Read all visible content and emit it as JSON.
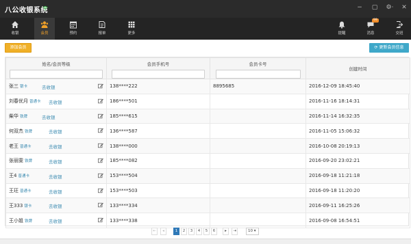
{
  "app": {
    "title": "八公收银系统"
  },
  "window": {
    "minimize": "−",
    "maximize": "▢",
    "settings": "⚙·",
    "close": "✕"
  },
  "nav": {
    "left": [
      {
        "label": "收银",
        "icon": "home-icon"
      },
      {
        "label": "会员",
        "icon": "members-icon",
        "active": true
      },
      {
        "label": "预约",
        "icon": "calendar-icon"
      },
      {
        "label": "报单",
        "icon": "report-icon"
      },
      {
        "label": "更多",
        "icon": "grid-icon"
      }
    ],
    "right": [
      {
        "label": "提醒",
        "icon": "bell-icon"
      },
      {
        "label": "消息",
        "icon": "message-icon",
        "badge": "99"
      },
      {
        "label": "交班",
        "icon": "exit-icon"
      }
    ]
  },
  "toolbar": {
    "add_label": "添加会员",
    "refresh_label": "更新会员信息"
  },
  "table": {
    "headers": {
      "name": "姓名/会员等级",
      "phone": "会员手机号",
      "card": "会员卡号",
      "created": "创建时间"
    },
    "rows": [
      {
        "name": "张三",
        "level": "银卡",
        "cashier": "去收银",
        "phone": "138****222",
        "card": "8895685",
        "created": "2016-12-09 18:45:40"
      },
      {
        "name": "刘春优月",
        "level": "普通卡",
        "cashier": "去收银",
        "phone": "186****501",
        "card": "",
        "created": "2016-11-16 18:14:31"
      },
      {
        "name": "柴华",
        "level": "铁牌",
        "cashier": "去收银",
        "phone": "185****615",
        "card": "",
        "created": "2016-11-14 16:32:35"
      },
      {
        "name": "何双杰",
        "level": "铁牌",
        "cashier": "去收银",
        "phone": "136****587",
        "card": "",
        "created": "2016-11-05 15:06:32"
      },
      {
        "name": "老王",
        "level": "普通卡",
        "cashier": "去收银",
        "phone": "138****000",
        "card": "",
        "created": "2016-10-08 20:19:13"
      },
      {
        "name": "张丽雯",
        "level": "铁牌",
        "cashier": "去收银",
        "phone": "185****082",
        "card": "",
        "created": "2016-09-20 23:02:21"
      },
      {
        "name": "王4",
        "level": "普通卡",
        "cashier": "去收银",
        "phone": "153****504",
        "card": "",
        "created": "2016-09-18 11:21:18"
      },
      {
        "name": "王玨",
        "level": "普通卡",
        "cashier": "去收银",
        "phone": "153****503",
        "card": "",
        "created": "2016-09-18 11:20:20"
      },
      {
        "name": "王333",
        "level": "银卡",
        "cashier": "去收银",
        "phone": "133****334",
        "card": "",
        "created": "2016-09-11 16:25:26"
      },
      {
        "name": "王小姐",
        "level": "铁牌",
        "cashier": "去收银",
        "phone": "133****338",
        "card": "",
        "created": "2016-09-08 16:54:51"
      }
    ]
  },
  "pagination": {
    "first": "⇤",
    "prev": "◂",
    "pages": [
      "1",
      "2",
      "3",
      "4",
      "5",
      "6"
    ],
    "current": "1",
    "next": "▸",
    "last": "⇥",
    "page_size": "10 ▾"
  },
  "colors": {
    "accent": "#f0b028",
    "refresh": "#3fa8c9",
    "active_page": "#2f79b8",
    "link": "#3a8ab0"
  }
}
